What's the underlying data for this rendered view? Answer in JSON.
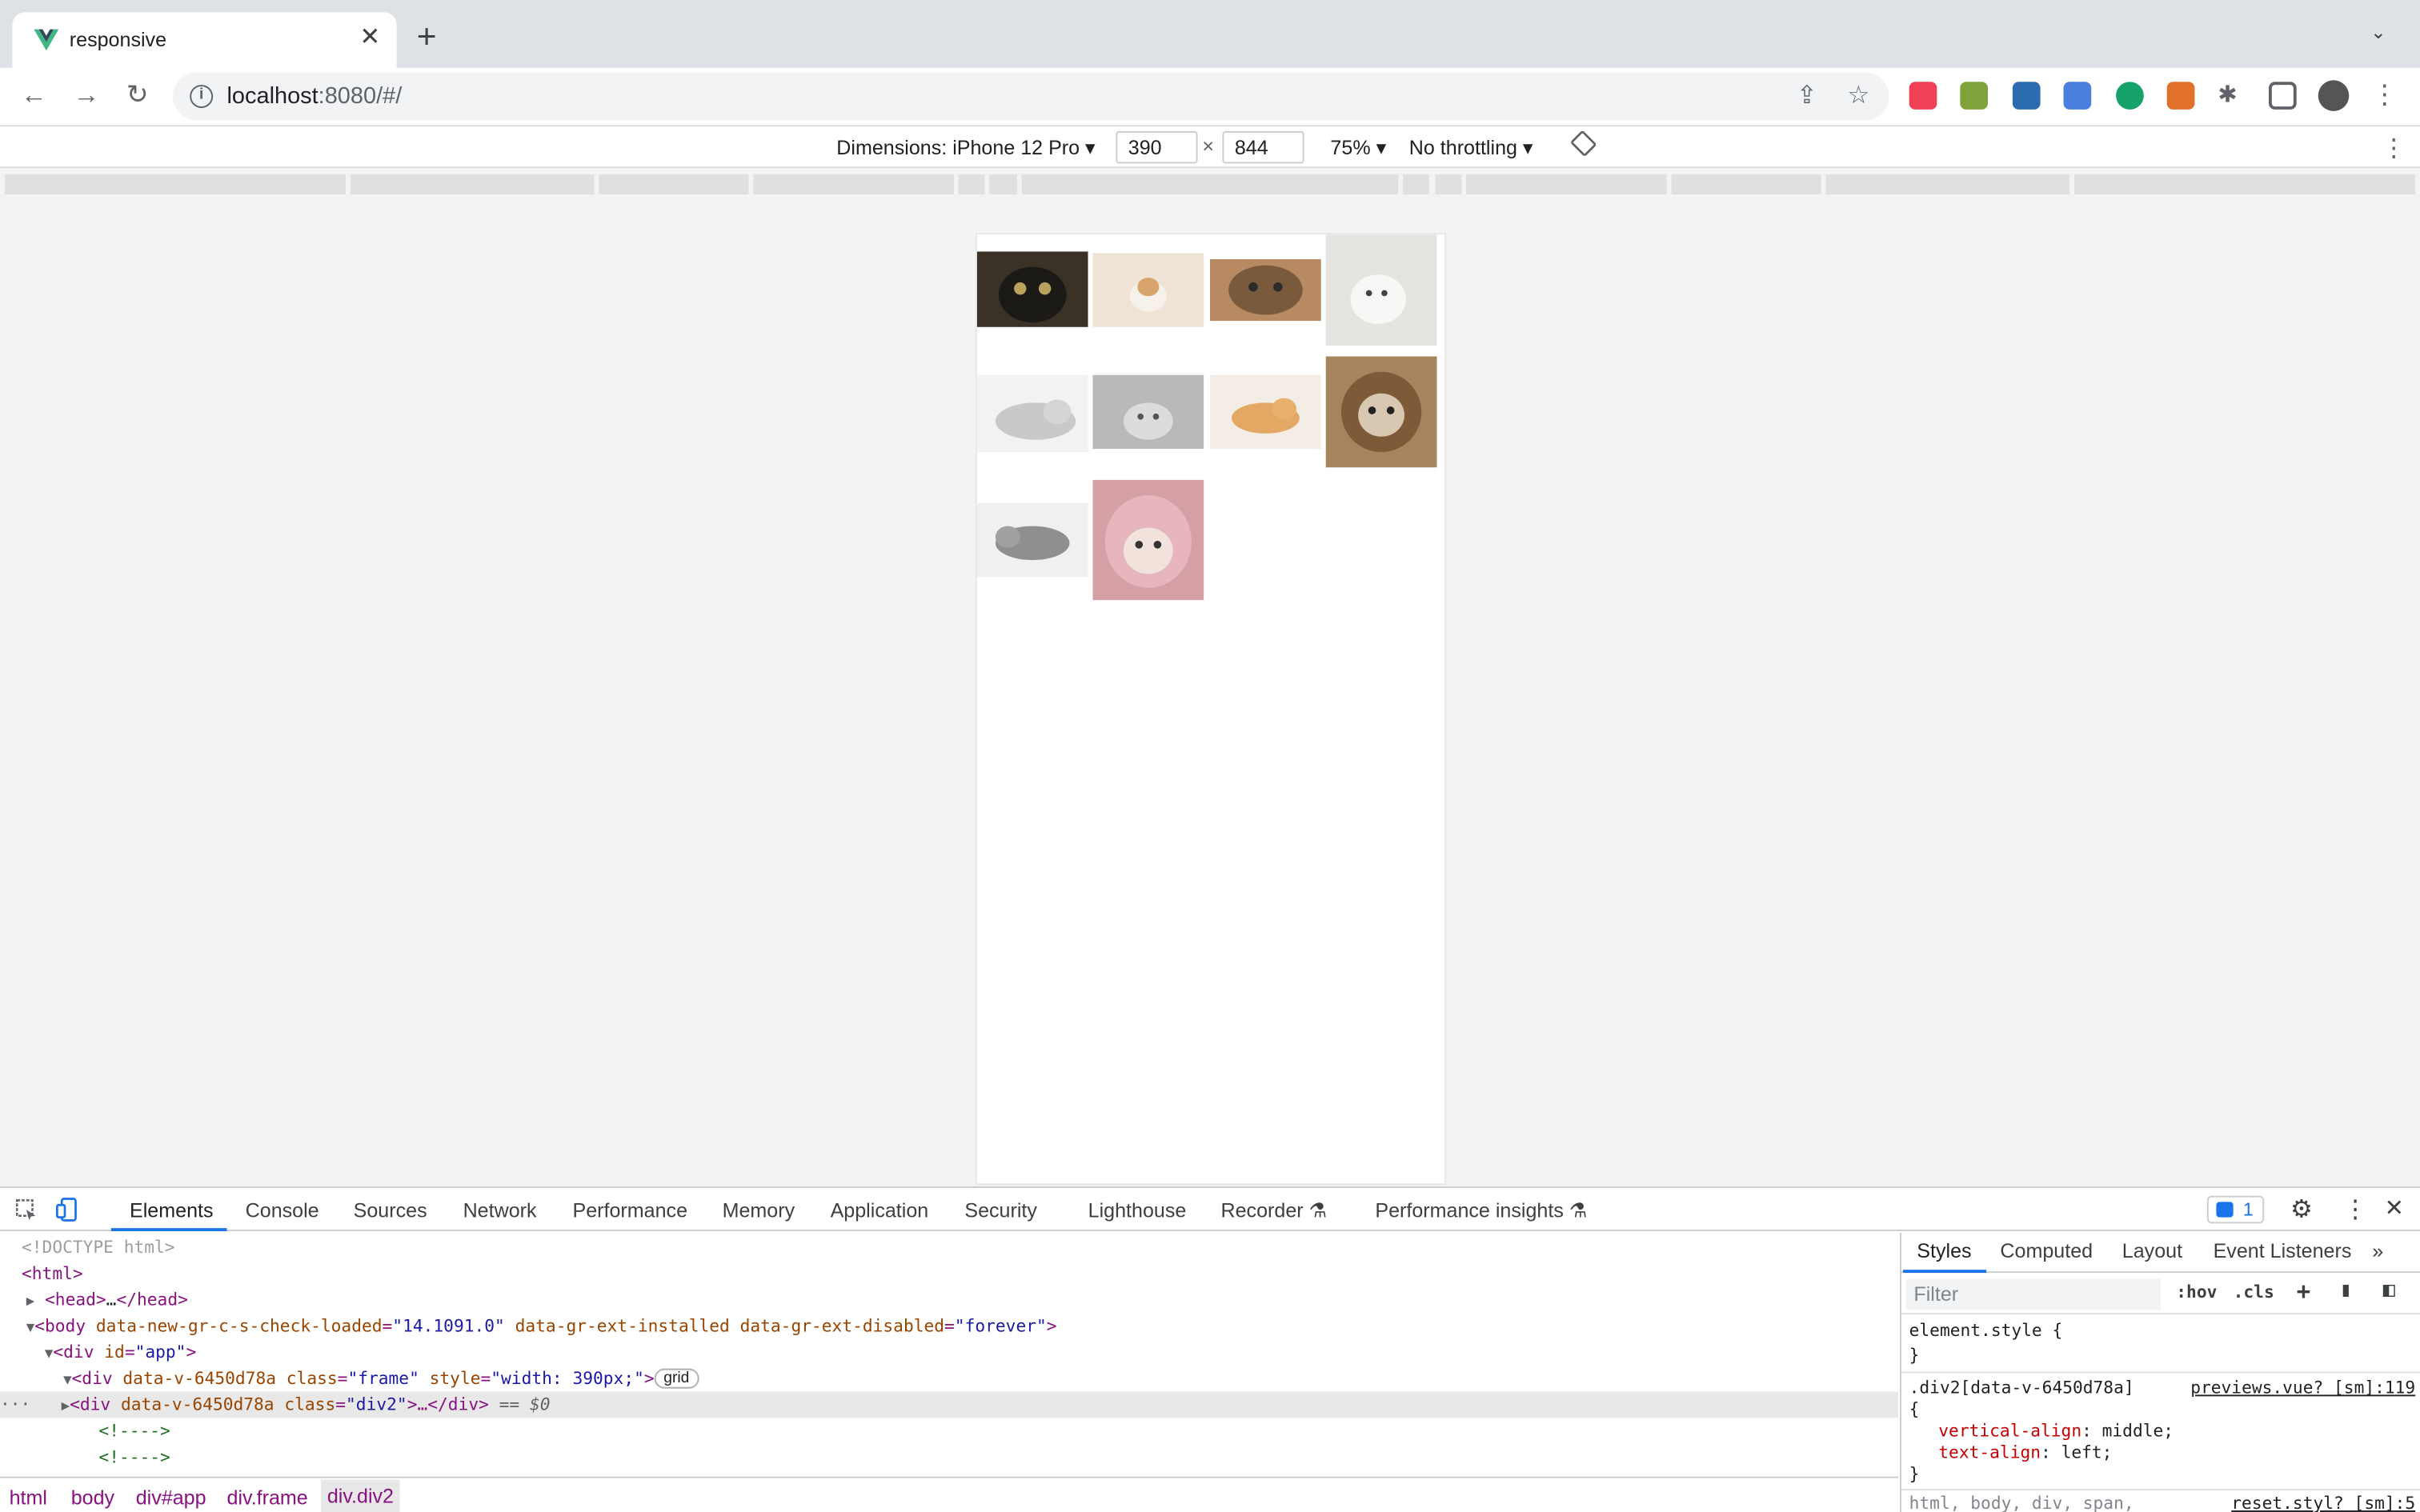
{
  "tab": {
    "title": "responsive",
    "close": "✕"
  },
  "toolbar": {
    "url_host": "localhost",
    "url_path": ":8080/#/"
  },
  "device_toolbar": {
    "dimensions_label": "Dimensions: iPhone 12 Pro ▾",
    "width": "390",
    "height": "844",
    "times": "×",
    "zoom": "75% ▾",
    "throttling": "No throttling ▾"
  },
  "viewport": {
    "images": [
      {
        "name": "black-cat-image",
        "color": "#3a3226"
      },
      {
        "name": "kitten-pillow-image",
        "color": "#e9d8c4"
      },
      {
        "name": "tabby-cat-image",
        "color": "#8c6a4a"
      },
      {
        "name": "white-kitten-image",
        "color": "#d7d4d0"
      },
      {
        "name": "grey-cat-lying-image",
        "color": "#d9d9db"
      },
      {
        "name": "grey-kitten-image",
        "color": "#b4b4b6"
      },
      {
        "name": "orange-cat-image",
        "color": "#e6b57a"
      },
      {
        "name": "lion-hood-cat-image",
        "color": "#9c7a55"
      },
      {
        "name": "silver-tabby-image",
        "color": "#aaaaab"
      },
      {
        "name": "pink-hood-cat-image",
        "color": "#d89ca4"
      }
    ]
  },
  "devtools": {
    "tabs": [
      "Elements",
      "Console",
      "Sources",
      "Network",
      "Performance",
      "Memory",
      "Application",
      "Security",
      "Lighthouse",
      "Recorder ⚗",
      "Performance insights ⚗"
    ],
    "issues_count": "1",
    "dom_lines": {
      "doctype": "<!DOCTYPE html>",
      "html": "<html>",
      "head_open": "<head>",
      "head_dots": "…",
      "head_close": "</head>",
      "body_tag": "<body",
      "body_attr1": "data-new-gr-c-s-check-loaded",
      "body_val1": "\"14.1091.0\"",
      "body_attr2": "data-gr-ext-installed",
      "body_attr3": "data-gr-ext-disabled",
      "body_val3": "\"forever\"",
      "gt": ">",
      "eq": "=",
      "div_tag": "<div",
      "app_attr": "id",
      "app_val": "\"app\"",
      "frame_attr1": "data-v-6450d78a",
      "frame_attr2": "class",
      "frame_val2": "\"frame\"",
      "frame_attr3": "style",
      "frame_val3": "\"width: 390px;\"",
      "grid_badge": "grid",
      "div2_val": "\"div2\"",
      "div2_end": "…</div>",
      "sel_marker": "== $0",
      "comment": "<!---->"
    },
    "breadcrumbs": [
      "html",
      "body",
      "div#app",
      "div.frame",
      "div.div2"
    ],
    "styles": {
      "tabs": [
        "Styles",
        "Computed",
        "Layout",
        "Event Listeners"
      ],
      "filter_placeholder": "Filter",
      "hov": ":hov",
      "cls": ".cls",
      "element_style": "element.style {",
      "close_brace": "}",
      "open_brace": "{",
      "selector": ".div2[data-v-6450d78a]",
      "source1": "previews.vue? [sm]:119",
      "prop1": "vertical-align",
      "val1": ": middle;",
      "prop2": "text-align",
      "val2": ": left;",
      "selector2": "html, body, div, span,",
      "source2": "reset.styl? [sm]:5"
    }
  },
  "colors": {
    "accent": "#1a73e8",
    "tag": "#881280",
    "attr": "#994500",
    "value": "#1a1aa6"
  }
}
